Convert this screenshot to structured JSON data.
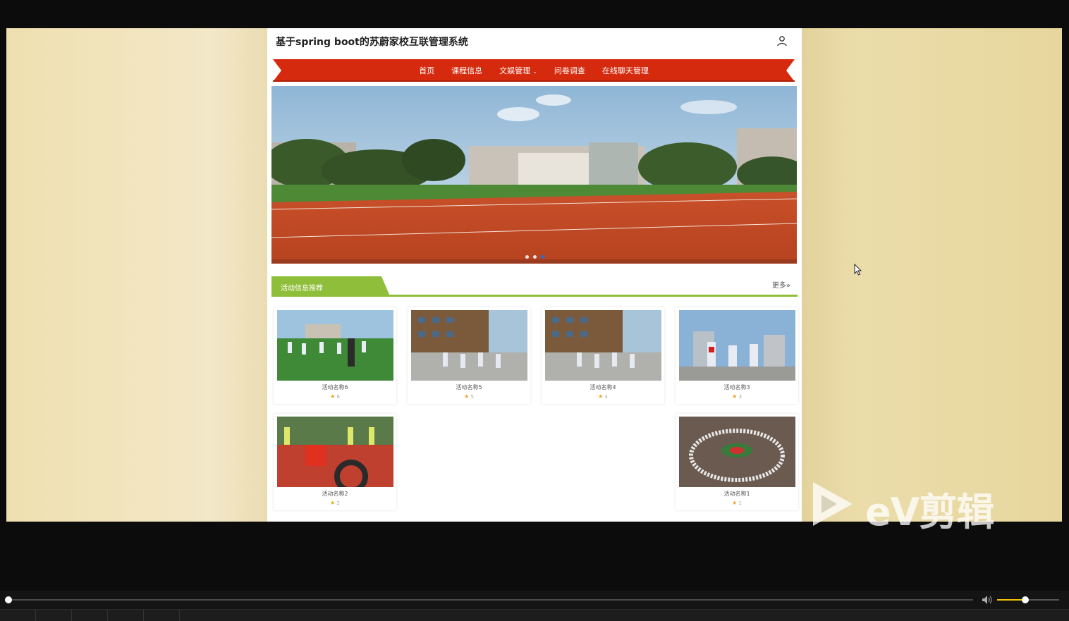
{
  "site": {
    "title": "基于spring boot的苏蔚家校互联管理系统"
  },
  "nav": {
    "items": [
      {
        "label": "首页",
        "active": true,
        "dropdown": false
      },
      {
        "label": "课程信息",
        "active": false,
        "dropdown": false
      },
      {
        "label": "文娱管理",
        "active": false,
        "dropdown": true
      },
      {
        "label": "问卷调查",
        "active": false,
        "dropdown": false
      },
      {
        "label": "在线聊天管理",
        "active": false,
        "dropdown": false
      }
    ],
    "caret": "⌄"
  },
  "banner": {
    "dots": 3,
    "active_dot": 2
  },
  "section": {
    "title": "活动信息推荐",
    "more": "更多»"
  },
  "activities": [
    {
      "name": "活动名称6",
      "count": "6",
      "image": "students-running-on-field"
    },
    {
      "name": "活动名称5",
      "count": "5",
      "image": "students-exercising-in-schoolyard"
    },
    {
      "name": "活动名称4",
      "count": "4",
      "image": "students-exercising-in-schoolyard"
    },
    {
      "name": "活动名称3",
      "count": "3",
      "image": "students-cheering"
    },
    {
      "name": "活动名称2",
      "count": "2",
      "image": "students-rolling-tire"
    },
    {
      "name": "活动名称1",
      "count": "1",
      "image": "students-in-circle"
    }
  ],
  "watermark": {
    "text": "eV剪辑"
  },
  "player": {
    "progress": 0.0,
    "volume": 0.45
  },
  "colors": {
    "nav_red": "#d62a0e",
    "section_green": "#8fbf3a",
    "star": "#f0a020"
  }
}
